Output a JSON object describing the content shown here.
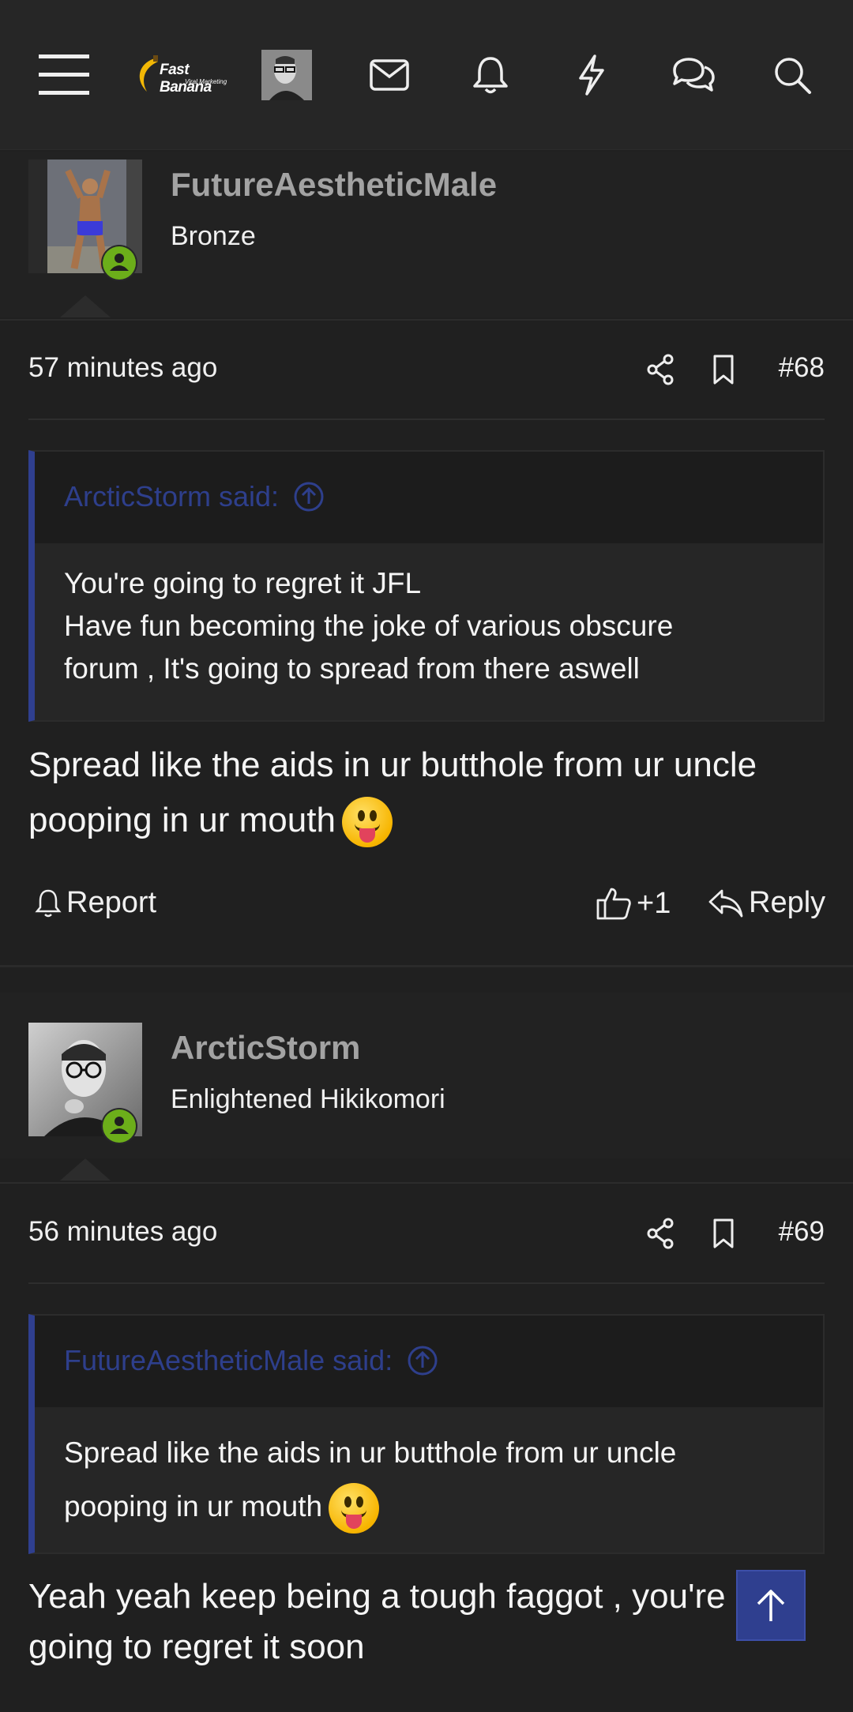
{
  "header": {
    "logo_text": "Fast Banana",
    "logo_sub": "Viral Marketing",
    "icons": [
      "menu-icon",
      "envelope-icon",
      "bell-icon",
      "bolt-icon",
      "chat-icon",
      "search-icon"
    ]
  },
  "posts": [
    {
      "username": "FutureAestheticMale",
      "user_title": "Bronze",
      "time": "57 minutes ago",
      "number": "#68",
      "quote": {
        "attribution": "ArcticStorm said:",
        "lines": [
          "You're going to regret it JFL",
          "Have fun becoming the joke of various obscure",
          "forum , It's going to spread from there aswell"
        ]
      },
      "body_lines": [
        "Spread like the aids in ur butthole from ur uncle",
        "pooping in ur mouth"
      ],
      "actions": {
        "report": "Report",
        "likes": "+1",
        "reply": "Reply"
      }
    },
    {
      "username": "ArcticStorm",
      "user_title": "Enlightened Hikikomori",
      "time": "56 minutes ago",
      "number": "#69",
      "quote": {
        "attribution": "FutureAestheticMale said:",
        "lines": [
          "Spread like the aids in ur butthole from ur uncle",
          "pooping in ur mouth"
        ]
      },
      "body_lines": [
        "Yeah yeah keep being a tough faggot , you're",
        "going to regret it soon"
      ]
    }
  ],
  "colors": {
    "background": "#202020",
    "header": "#262626",
    "quote_accent": "#2f3f8f",
    "online_green": "#6cae1a",
    "username_gray": "#a3a3a3"
  }
}
